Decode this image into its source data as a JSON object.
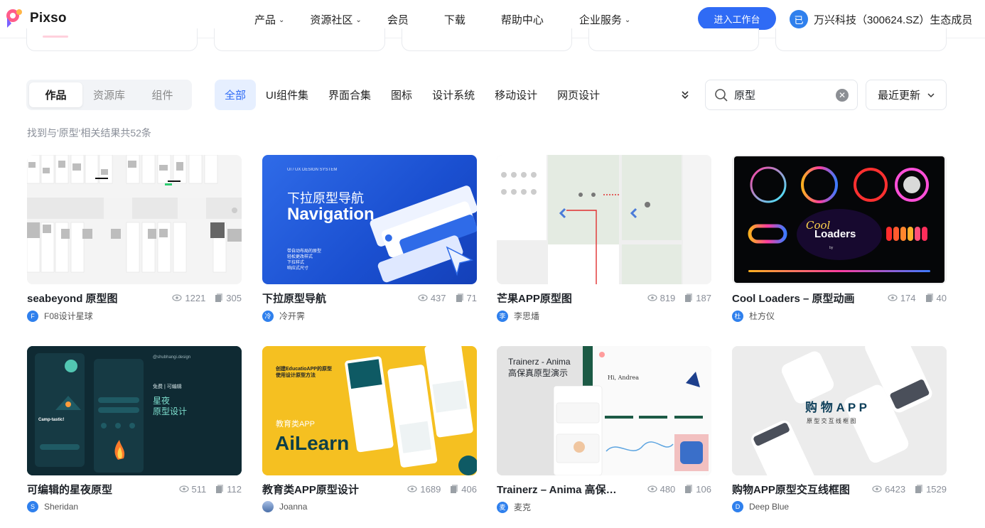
{
  "header": {
    "logo_text": "Pixso",
    "nav": [
      {
        "label": "产品",
        "has_dropdown": true
      },
      {
        "label": "资源社区",
        "has_dropdown": true
      },
      {
        "label": "会员",
        "has_dropdown": false
      },
      {
        "label": "下载",
        "has_dropdown": false
      },
      {
        "label": "帮助中心",
        "has_dropdown": false
      },
      {
        "label": "企业服务",
        "has_dropdown": true
      }
    ],
    "enter_button": "进入工作台",
    "member_badge": "已",
    "member_text": "万兴科技（300624.SZ）生态成员"
  },
  "tabs": [
    "作品",
    "资源库",
    "组件"
  ],
  "active_tab": "作品",
  "filters": [
    "全部",
    "UI组件集",
    "界面合集",
    "图标",
    "设计系统",
    "移动设计",
    "网页设计"
  ],
  "active_filter": "全部",
  "search": {
    "value": "原型"
  },
  "sort": {
    "label": "最近更新"
  },
  "result_text": "找到与'原型'相关结果共52条",
  "colors": {
    "accent": "#2f6bf5",
    "active_filter_bg": "#e6efff"
  },
  "cards": [
    {
      "title": "seabeyond 原型图",
      "views": "1221",
      "copies": "305",
      "author": "F08设计星球",
      "avatar_letter": "F",
      "avatar_color": "#2f80ed"
    },
    {
      "title": "下拉原型导航",
      "views": "437",
      "copies": "71",
      "author": "冷开霁",
      "avatar_letter": "冷",
      "avatar_color": "#2f80ed",
      "thumb": {
        "kicker": "UI / UX DESIGN SYSTEM",
        "title_cn": "下拉原型导航",
        "title_en": "Navigation",
        "bullets": [
          "带自动布局的原型",
          "轻松更改样式",
          "下拉样式",
          "响应式尺寸"
        ]
      }
    },
    {
      "title": "芒果APP原型图",
      "views": "819",
      "copies": "187",
      "author": "李思燔",
      "avatar_letter": "李",
      "avatar_color": "#2f80ed"
    },
    {
      "title": "Cool Loaders – 原型动画",
      "views": "174",
      "copies": "40",
      "author": "杜方仪",
      "avatar_letter": "杜",
      "avatar_color": "#2f80ed",
      "thumb": {
        "word1": "Cool",
        "word2": "Loaders",
        "by": "by"
      }
    },
    {
      "title": "可编辑的星夜原型",
      "views": "511",
      "copies": "112",
      "author": "Sheridan",
      "avatar_letter": "S",
      "avatar_color": "#2f80ed",
      "thumb": {
        "handle": "@shubhangi.design",
        "tags": "免费 | 可编辑",
        "title1": "星夜",
        "title2": "原型设计",
        "left_title": "Camp-tastic!"
      }
    },
    {
      "title": "教育类APP原型设计",
      "views": "1689",
      "copies": "406",
      "author": "Joanna",
      "avatar_letter": "",
      "avatar_color": "#6b8cc7",
      "thumb": {
        "line1": "创建EducatioAPP的原型",
        "line2": "使用设计原型方法",
        "sub": "教育类APP",
        "big": "AiLearn"
      }
    },
    {
      "title": "Trainerz – Anima 高保…",
      "views": "480",
      "copies": "106",
      "author": "麦克",
      "avatar_letter": "麦",
      "avatar_color": "#2f80ed",
      "thumb": {
        "line1": "Trainerz - Anima",
        "line2": "高保真原型演示",
        "hi": "Hi, Andrea"
      }
    },
    {
      "title": "购物APP原型交互线框图",
      "views": "6423",
      "copies": "1529",
      "author": "Deep Blue",
      "avatar_letter": "D",
      "avatar_color": "#2f80ed",
      "thumb": {
        "big": "购 物 A P P",
        "sub": "原 型 交 互 线 框 图"
      }
    }
  ]
}
